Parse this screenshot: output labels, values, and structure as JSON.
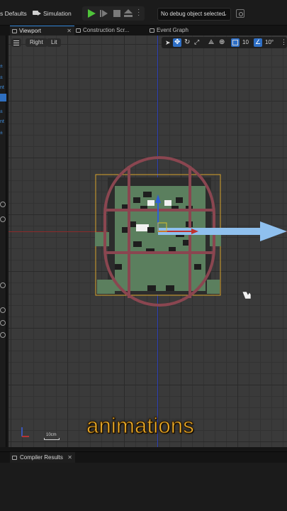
{
  "toolbar": {
    "class_defaults_label": "s Defaults",
    "simulation_label": "Simulation",
    "debug_select_value": "No debug object selected"
  },
  "tabs": [
    {
      "label": "Viewport",
      "active": true
    },
    {
      "label": "Construction Scr..."
    },
    {
      "label": "Event Graph"
    }
  ],
  "viewport": {
    "view_mode": "Right",
    "lighting_mode": "Lit",
    "grid_snap_value": "10",
    "rotation_snap_value": "10°",
    "scale_label": "10cm"
  },
  "caption": "animations",
  "bottom": {
    "compiler_results_label": "Compiler Results"
  },
  "colors": {
    "accent": "#2e6fc6",
    "play_green": "#4fc43a",
    "caption_orange": "#f2b22c",
    "capsule": "#8a4650",
    "sprite_green": "#5b7f5e",
    "arrow_blue": "#8fc0ee"
  },
  "icons": [
    "simulation-icon",
    "play-icon",
    "step-icon",
    "stop-icon",
    "eject-icon",
    "more-icon",
    "debug-filter-icon",
    "hamburger-icon",
    "select-icon",
    "translate-icon",
    "rotate-icon",
    "scale-icon",
    "surface-snap-icon",
    "world-local-icon",
    "grid-snap-icon",
    "angle-snap-icon",
    "camera-speed-icon"
  ]
}
